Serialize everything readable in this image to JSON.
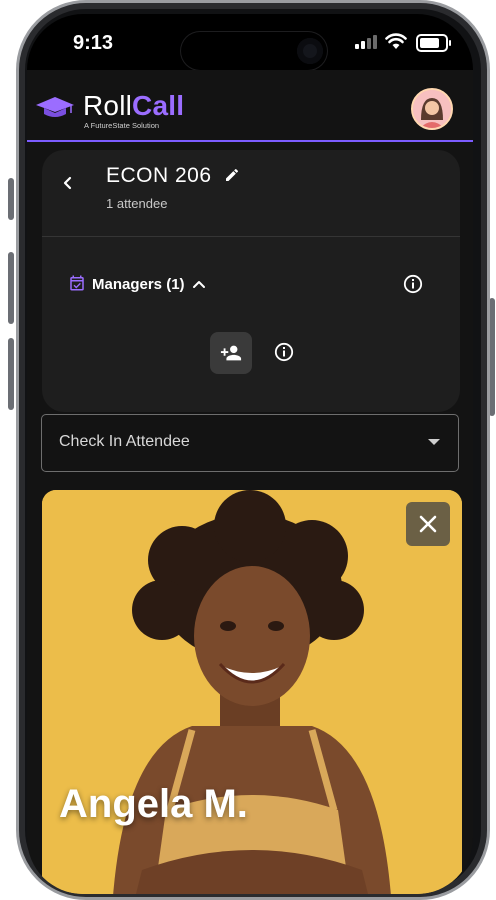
{
  "status_bar": {
    "time": "9:13"
  },
  "app": {
    "brand_part1": "Roll",
    "brand_part2": "Call",
    "tagline": "A FutureState Solution"
  },
  "course": {
    "title": "ECON 206",
    "attendee_count_text": "1 attendee"
  },
  "managers": {
    "label": "Managers (1)"
  },
  "check_in": {
    "placeholder": "Check In Attendee"
  },
  "attendee_card": {
    "name": "Angela M."
  },
  "colors": {
    "accent": "#9b6dff",
    "card_bg": "#1e1e1e",
    "photo_bg": "#ecbd4a"
  }
}
